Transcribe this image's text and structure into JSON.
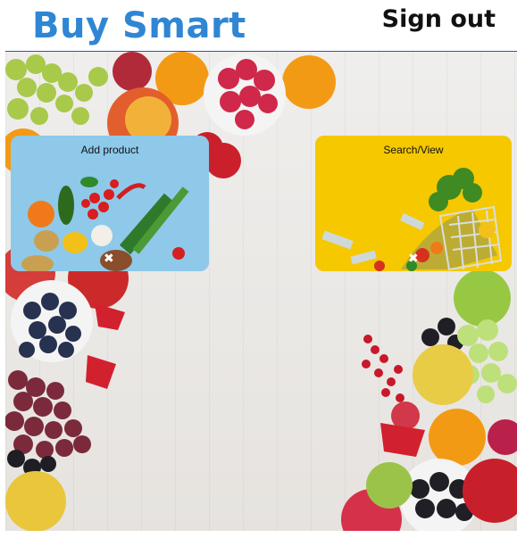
{
  "header": {
    "brand": "Buy Smart",
    "sign_out": "Sign out"
  },
  "cards": {
    "add_product": {
      "label": "Add product"
    },
    "search_view": {
      "label": "Search/View"
    }
  },
  "colors": {
    "brand": "#2f86d3",
    "divider": "#2e4bd8",
    "add_card_bg": "#8ec9ea",
    "search_card_bg": "#f5c800"
  }
}
